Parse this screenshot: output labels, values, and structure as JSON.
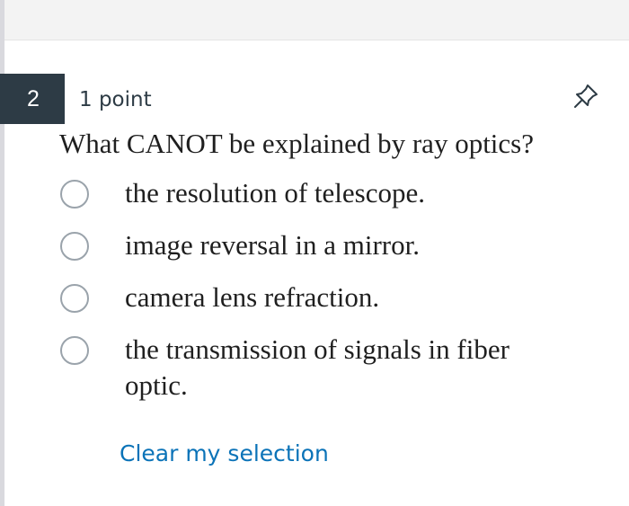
{
  "question": {
    "number": "2",
    "points": "1 point",
    "prompt": "What CANOT be explained by ray optics?",
    "options": [
      {
        "label": "the resolution of telescope.",
        "selected": false
      },
      {
        "label": "image reversal in a mirror.",
        "selected": false
      },
      {
        "label": "camera lens refraction.",
        "selected": false
      },
      {
        "label": "the transmission of signals in fiber optic.",
        "selected": false
      }
    ],
    "clear_label": "Clear my selection"
  },
  "icons": {
    "pin": "pin-icon",
    "radio": "radio-unchecked-icon"
  },
  "colors": {
    "number_badge_bg": "#2d3b45",
    "link": "#0b73b8",
    "radio_border": "#9aa3ab"
  }
}
